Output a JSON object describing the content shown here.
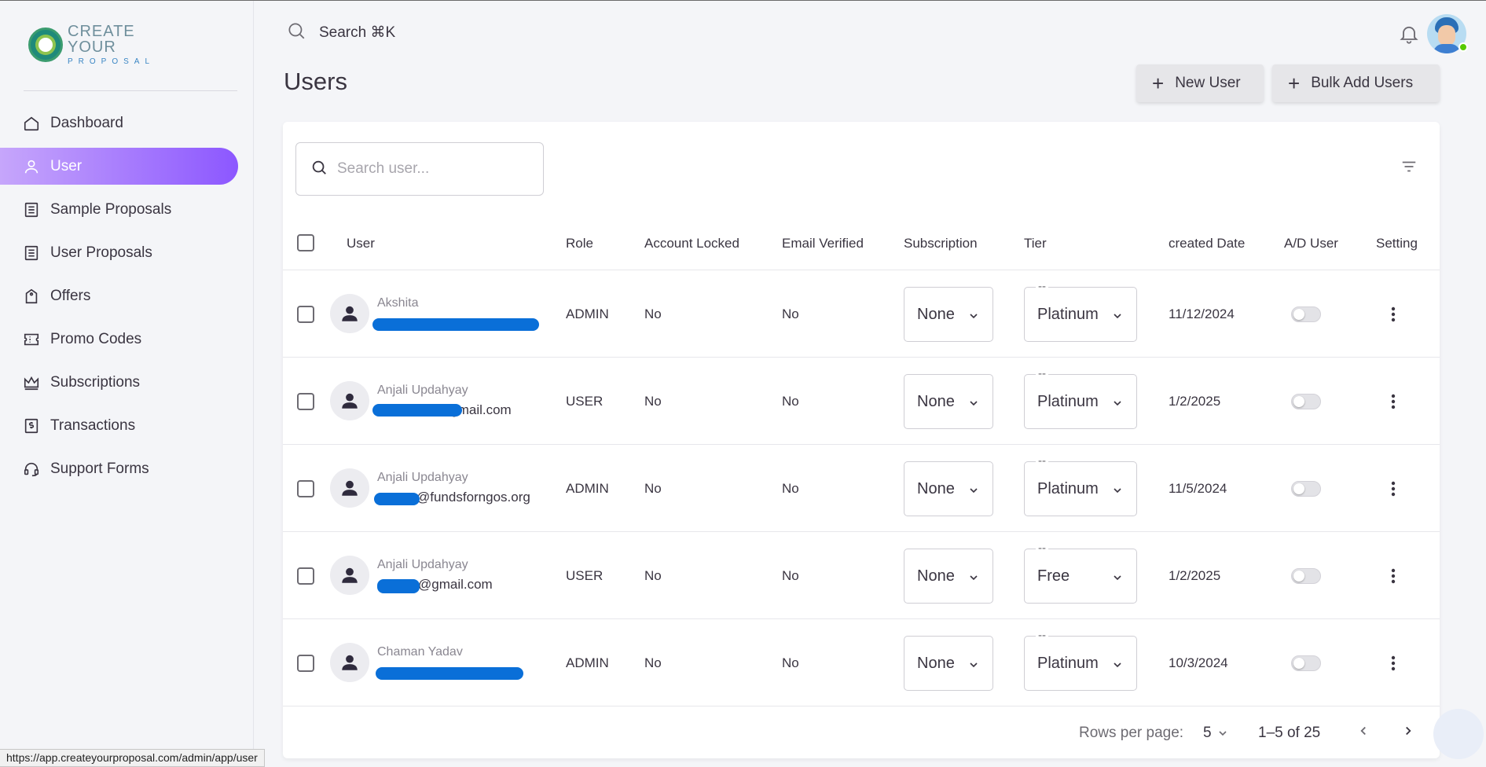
{
  "brand": {
    "line1": "CREATE YOUR",
    "line2": "PROPOSAL"
  },
  "sidebar": {
    "items": [
      {
        "label": "Dashboard",
        "icon": "home-icon"
      },
      {
        "label": "User",
        "icon": "user-icon",
        "active": true
      },
      {
        "label": "Sample Proposals",
        "icon": "document-icon"
      },
      {
        "label": "User Proposals",
        "icon": "document-icon"
      },
      {
        "label": "Offers",
        "icon": "tag-icon"
      },
      {
        "label": "Promo Codes",
        "icon": "ticket-icon"
      },
      {
        "label": "Subscriptions",
        "icon": "crown-icon"
      },
      {
        "label": "Transactions",
        "icon": "dollar-icon"
      },
      {
        "label": "Support Forms",
        "icon": "headset-icon"
      }
    ]
  },
  "topbar": {
    "search_label": "Search ⌘K"
  },
  "page": {
    "title": "Users",
    "new_user_label": "New User",
    "bulk_add_label": "Bulk Add Users"
  },
  "table": {
    "search_placeholder": "Search user...",
    "columns": {
      "user": "User",
      "role": "Role",
      "locked": "Account Locked",
      "verified": "Email Verified",
      "subscription": "Subscription",
      "tier": "Tier",
      "created": "created Date",
      "ad": "A/D User",
      "setting": "Setting"
    },
    "rows": [
      {
        "name": "Akshita",
        "email": "",
        "role": "ADMIN",
        "locked": "No",
        "verified": "No",
        "subscription": "None",
        "tier_legend": "--",
        "tier": "Platinum",
        "created": "11/12/2024",
        "enabled": false
      },
      {
        "name": "Anjali Updahyay",
        "email": "@gmail.com",
        "role": "USER",
        "locked": "No",
        "verified": "No",
        "subscription": "None",
        "tier_legend": "--",
        "tier": "Platinum",
        "created": "1/2/2025",
        "enabled": false
      },
      {
        "name": "Anjali Updahyay",
        "email": "@fundsforngos.org",
        "role": "ADMIN",
        "locked": "No",
        "verified": "No",
        "subscription": "None",
        "tier_legend": "--",
        "tier": "Platinum",
        "created": "11/5/2024",
        "enabled": false
      },
      {
        "name": "Anjali Updahyay",
        "email": "@gmail.com",
        "role": "USER",
        "locked": "No",
        "verified": "No",
        "subscription": "None",
        "tier_legend": "--",
        "tier": "Free",
        "created": "1/2/2025",
        "enabled": false
      },
      {
        "name": "Chaman Yadav",
        "email": "",
        "role": "ADMIN",
        "locked": "No",
        "verified": "No",
        "subscription": "None",
        "tier_legend": "--",
        "tier": "Platinum",
        "created": "10/3/2024",
        "enabled": false
      }
    ]
  },
  "pagination": {
    "rows_per_page_label": "Rows per page:",
    "rows_per_page": "5",
    "range": "1–5 of 25"
  },
  "statusbar": {
    "url": "https://app.createyourproposal.com/admin/app/user"
  },
  "colors": {
    "accent": "#8c57ff",
    "accent_light": "#c6a6fb",
    "redaction": "#0a6fd8",
    "online": "#56ca00"
  }
}
